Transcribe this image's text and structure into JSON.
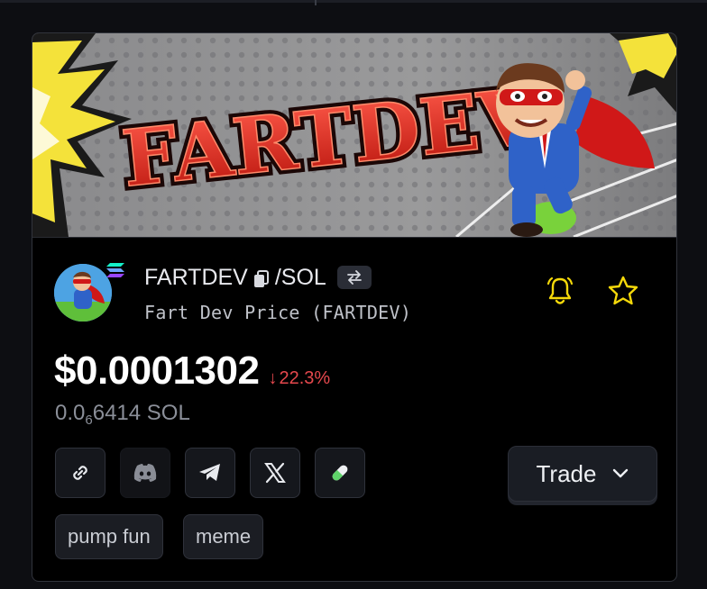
{
  "token": {
    "symbol": "FARTDEV",
    "quote": "/SOL",
    "name_line": "Fart Dev Price (FARTDEV)",
    "banner_text": "FARTDEV"
  },
  "price": {
    "usd": "$0.0001302",
    "change_arrow": "↓",
    "change": "22.3%",
    "sol_prefix": "0.0",
    "sol_sub": "6",
    "sol_suffix": "6414 SOL"
  },
  "socials": [
    "link-icon",
    "discord-icon",
    "telegram-icon",
    "x-icon",
    "pill-icon"
  ],
  "actions": {
    "trade_label": "Trade"
  },
  "tags": [
    "pump fun",
    "meme"
  ],
  "colors": {
    "negative": "#e5484d",
    "alert_yellow": "#f5d90a",
    "solana_teal": "#14f1c9",
    "solana_purple": "#9945ff"
  }
}
